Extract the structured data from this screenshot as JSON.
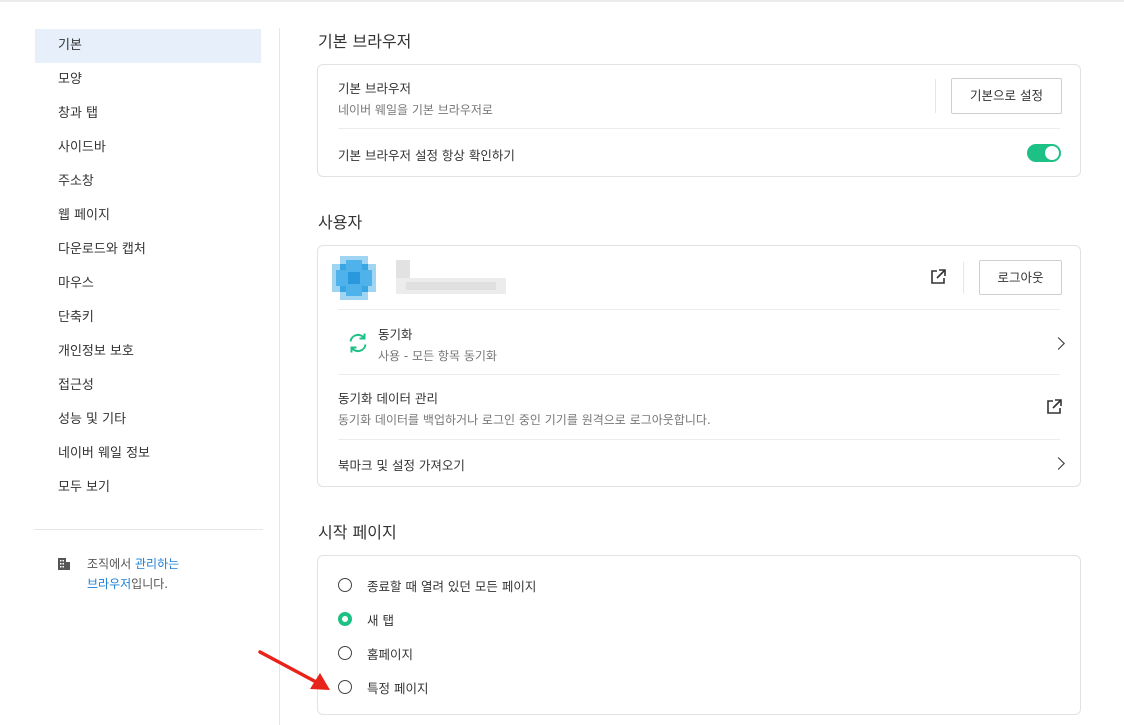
{
  "sidebar": {
    "items": [
      {
        "label": "기본"
      },
      {
        "label": "모양"
      },
      {
        "label": "창과 탭"
      },
      {
        "label": "사이드바"
      },
      {
        "label": "주소창"
      },
      {
        "label": "웹 페이지"
      },
      {
        "label": "다운로드와 캡처"
      },
      {
        "label": "마우스"
      },
      {
        "label": "단축키"
      },
      {
        "label": "개인정보 보호"
      },
      {
        "label": "접근성"
      },
      {
        "label": "성능 및 기타"
      },
      {
        "label": "네이버 웨일 정보"
      },
      {
        "label": "모두 보기"
      }
    ],
    "managed": {
      "prefix": "조직에서 ",
      "link_line1": "관리하는",
      "link_line2": "브라우저",
      "suffix": "입니다."
    }
  },
  "default_browser": {
    "section_title": "기본 브라우저",
    "row1_title": "기본 브라우저",
    "row1_sub": "네이버 웨일을 기본 브라우저로",
    "set_button": "기본으로 설정",
    "row2_title": "기본 브라우저 설정 항상 확인하기",
    "toggle_on": true
  },
  "user": {
    "section_title": "사용자",
    "logout_button": "로그아웃",
    "sync_title": "동기화",
    "sync_sub": "사용 - 모든 항목 동기화",
    "sync_data_title": "동기화 데이터 관리",
    "sync_data_sub": "동기화 데이터를 백업하거나 로그인 중인 기기를 원격으로 로그아웃합니다.",
    "import_title": "북마크 및 설정 가져오기"
  },
  "startup": {
    "section_title": "시작 페이지",
    "options": [
      {
        "label": "종료할 때 열려 있던 모든 페이지",
        "selected": false
      },
      {
        "label": "새 탭",
        "selected": true
      },
      {
        "label": "홈페이지",
        "selected": false
      },
      {
        "label": "특정 페이지",
        "selected": false
      }
    ]
  },
  "colors": {
    "accent": "#1ec185",
    "active_nav": "#e7f0fa",
    "link": "#1a7fd6",
    "annotation_arrow": "#e8231a"
  }
}
